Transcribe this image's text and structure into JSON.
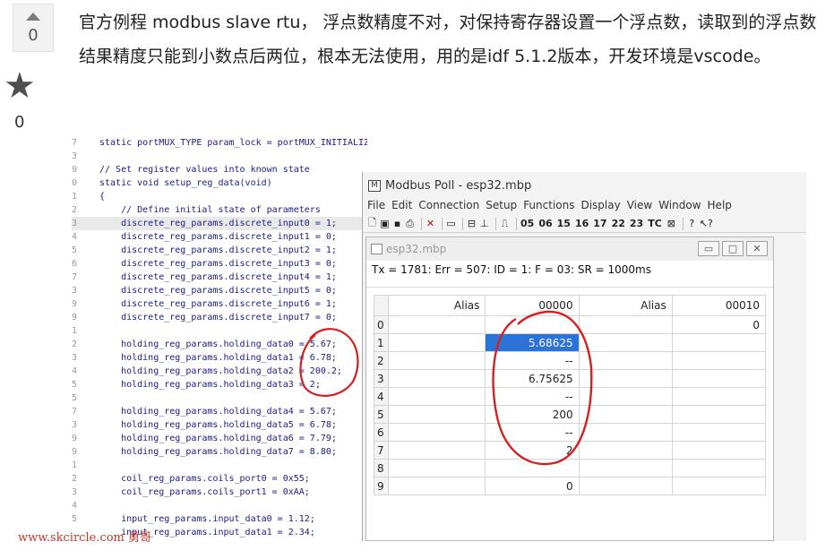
{
  "vote": {
    "score": "0",
    "star_count": "0"
  },
  "question": {
    "text": "官方例程 modbus slave rtu， 浮点数精度不对，对保持寄存器设置一个浮点数，读取到的浮点数结果精度只能到小数点后两位，根本无法使用，用的是idf 5.1.2版本，开发环境是vscode。"
  },
  "code": {
    "lines": [
      {
        "num": "7",
        "text": "static portMUX_TYPE param_lock = portMUX_INITIALIZER_UNLOCKED;"
      },
      {
        "num": "3",
        "text": ""
      },
      {
        "num": "9",
        "text": "// Set register values into known state"
      },
      {
        "num": "0",
        "text": "static void setup_reg_data(void)"
      },
      {
        "num": "1",
        "text": "{"
      },
      {
        "num": "2",
        "text": "    // Define initial state of parameters"
      },
      {
        "num": "3",
        "text": "    discrete_reg_params.discrete_input0 = 1;"
      },
      {
        "num": "4",
        "text": "    discrete_reg_params.discrete_input1 = 0;"
      },
      {
        "num": "5",
        "text": "    discrete_reg_params.discrete_input2 = 1;"
      },
      {
        "num": "6",
        "text": "    discrete_reg_params.discrete_input3 = 0;"
      },
      {
        "num": "7",
        "text": "    discrete_reg_params.discrete_input4 = 1;"
      },
      {
        "num": "3",
        "text": "    discrete_reg_params.discrete_input5 = 0;"
      },
      {
        "num": "9",
        "text": "    discrete_reg_params.discrete_input6 = 1;"
      },
      {
        "num": "9",
        "text": "    discrete_reg_params.discrete_input7 = 0;"
      },
      {
        "num": "1",
        "text": ""
      },
      {
        "num": "2",
        "text": "    holding_reg_params.holding_data0 = 5.67;"
      },
      {
        "num": "3",
        "text": "    holding_reg_params.holding_data1 = 6.78;"
      },
      {
        "num": "4",
        "text": "    holding_reg_params.holding_data2 = 200.2;"
      },
      {
        "num": "5",
        "text": "    holding_reg_params.holding_data3 = 2;"
      },
      {
        "num": "5",
        "text": ""
      },
      {
        "num": "7",
        "text": "    holding_reg_params.holding_data4 = 5.67;"
      },
      {
        "num": "3",
        "text": "    holding_reg_params.holding_data5 = 6.78;"
      },
      {
        "num": "9",
        "text": "    holding_reg_params.holding_data6 = 7.79;"
      },
      {
        "num": "9",
        "text": "    holding_reg_params.holding_data7 = 8.80;"
      },
      {
        "num": "1",
        "text": ""
      },
      {
        "num": "2",
        "text": "    coil_reg_params.coils_port0 = 0x55;"
      },
      {
        "num": "3",
        "text": "    coil_reg_params.coils_port1 = 0xAA;"
      },
      {
        "num": "4",
        "text": ""
      },
      {
        "num": "5",
        "text": "    input_reg_params.input_data0 = 1.12;"
      },
      {
        "num": "",
        "text": "    input_reg_params.input_data1 = 2.34;"
      }
    ]
  },
  "watermark": "www.skcircle.com 勇哥",
  "modbus_poll": {
    "window_title": "Modbus Poll - esp32.mbp",
    "menu": [
      "File",
      "Edit",
      "Connection",
      "Setup",
      "Functions",
      "Display",
      "View",
      "Window",
      "Help"
    ],
    "toolbar_codes": [
      "05",
      "06",
      "15",
      "16",
      "17",
      "22",
      "23",
      "TC"
    ],
    "child_title": "esp32.mbp",
    "status": "Tx = 1781: Err = 507: ID = 1: F = 03: SR = 1000ms",
    "columns": [
      "Alias",
      "00000",
      "Alias",
      "00010"
    ],
    "rows": [
      {
        "idx": "0",
        "v1": "",
        "v2": "0"
      },
      {
        "idx": "1",
        "v1": "5.68625",
        "v2": ""
      },
      {
        "idx": "2",
        "v1": "--",
        "v2": ""
      },
      {
        "idx": "3",
        "v1": "6.75625",
        "v2": ""
      },
      {
        "idx": "4",
        "v1": "--",
        "v2": ""
      },
      {
        "idx": "5",
        "v1": "200",
        "v2": ""
      },
      {
        "idx": "6",
        "v1": "--",
        "v2": ""
      },
      {
        "idx": "7",
        "v1": "2",
        "v2": ""
      },
      {
        "idx": "8",
        "v1": "",
        "v2": ""
      },
      {
        "idx": "9",
        "v1": "0",
        "v2": ""
      }
    ],
    "win_buttons": [
      "▭",
      "□",
      "✕"
    ]
  },
  "colors": {
    "annotation": "#d42020",
    "selection": "#2a73d8"
  }
}
